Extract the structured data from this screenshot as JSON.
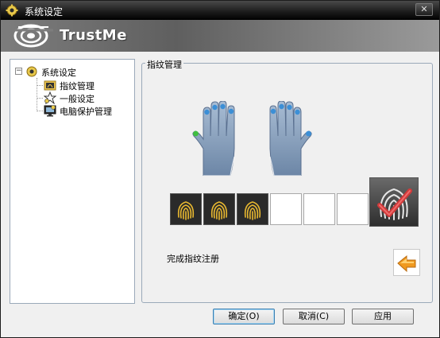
{
  "window": {
    "title": "系统设定",
    "close_glyph": "✕",
    "close_icon": "close-icon"
  },
  "banner": {
    "brand": "TrustMe",
    "logo_icon": "trustme-logo-icon"
  },
  "tree": {
    "toggle_glyph": "−",
    "root_label": "系统设定",
    "items": [
      {
        "label": "指纹管理",
        "icon": "fingerprint-folder-icon"
      },
      {
        "label": "一般设定",
        "icon": "star-settings-icon"
      },
      {
        "label": "电脑保护管理",
        "icon": "monitor-protect-icon"
      }
    ]
  },
  "panel": {
    "legend": "指纹管理",
    "enrolled_slots": [
      true,
      true,
      true,
      false,
      false,
      false
    ],
    "finger_dots": {
      "left_hand": "pinky, ring, middle, index: blue; thumb: green",
      "right_hand": "thumb, index, middle, ring, pinky: blue"
    },
    "status": "完成指纹注册"
  },
  "buttons": {
    "ok": "确定(O)",
    "cancel": "取消(C)",
    "apply": "应用"
  },
  "colors": {
    "accent_blue": "#3c8fd6",
    "enrolled_green": "#3fbf3f",
    "fingerprint_gold": "#e8b830",
    "check_red": "#d03a3a",
    "back_arrow_orange": "#f09a20"
  }
}
